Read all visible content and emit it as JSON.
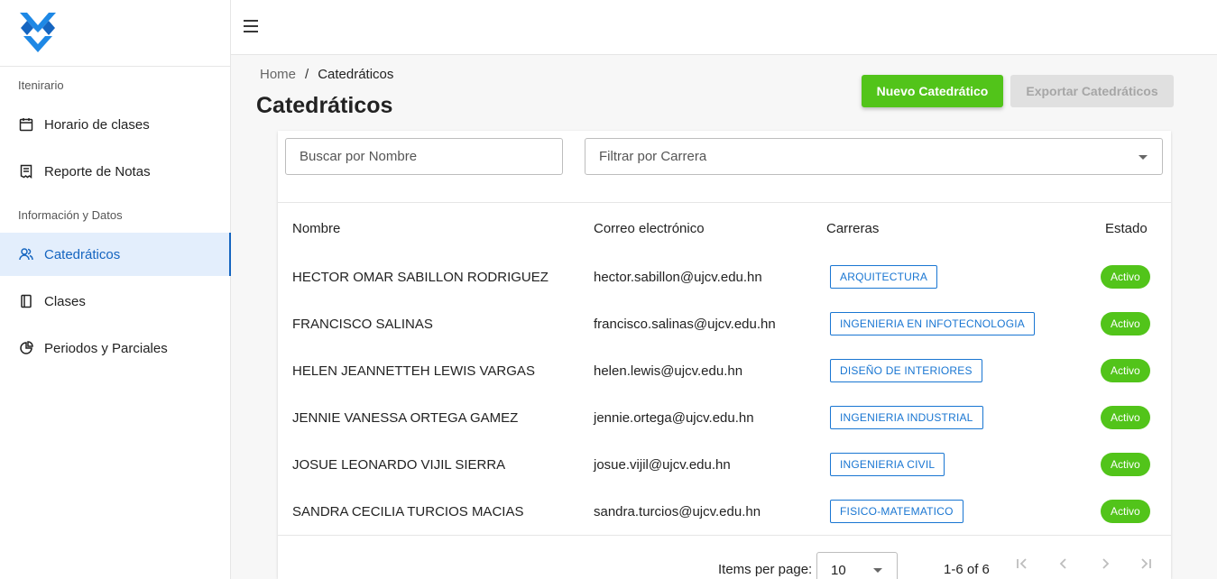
{
  "sidebar": {
    "section1": "Itenirario",
    "section2": "Información y Datos",
    "items": [
      {
        "label": "Horario de clases",
        "icon": "calendar-icon"
      },
      {
        "label": "Reporte de Notas",
        "icon": "report-icon"
      },
      {
        "label": "Catedráticos",
        "icon": "users-icon",
        "active": true
      },
      {
        "label": "Clases",
        "icon": "book-icon"
      },
      {
        "label": "Periodos y Parciales",
        "icon": "pie-chart-icon"
      }
    ]
  },
  "breadcrumb": {
    "home": "Home",
    "separator": "/",
    "current": "Catedráticos"
  },
  "page": {
    "title": "Catedráticos"
  },
  "buttons": {
    "new": "Nuevo Catedrático",
    "export": "Exportar Catedráticos"
  },
  "filters": {
    "search_placeholder": "Buscar por Nombre",
    "career_placeholder": "Filtrar por Carrera"
  },
  "table": {
    "headers": {
      "name": "Nombre",
      "email": "Correo electrónico",
      "careers": "Carreras",
      "status": "Estado"
    },
    "rows": [
      {
        "name": "HECTOR OMAR SABILLON RODRIGUEZ",
        "email": "hector.sabillon@ujcv.edu.hn",
        "career": "ARQUITECTURA",
        "status": "Activo"
      },
      {
        "name": "FRANCISCO SALINAS",
        "email": "francisco.salinas@ujcv.edu.hn",
        "career": "INGENIERIA EN INFOTECNOLOGIA",
        "status": "Activo"
      },
      {
        "name": "HELEN JEANNETTEH LEWIS VARGAS",
        "email": "helen.lewis@ujcv.edu.hn",
        "career": "DISEÑO DE INTERIORES",
        "status": "Activo"
      },
      {
        "name": "JENNIE VANESSA ORTEGA GAMEZ",
        "email": "jennie.ortega@ujcv.edu.hn",
        "career": "INGENIERIA INDUSTRIAL",
        "status": "Activo"
      },
      {
        "name": "JOSUE LEONARDO VIJIL SIERRA",
        "email": "josue.vijil@ujcv.edu.hn",
        "career": "INGENIERIA CIVIL",
        "status": "Activo"
      },
      {
        "name": "SANDRA CECILIA TURCIOS MACIAS",
        "email": "sandra.turcios@ujcv.edu.hn",
        "career": "FISICO-MATEMATICO",
        "status": "Activo"
      }
    ]
  },
  "pagination": {
    "items_per_page_label": "Items per page:",
    "items_per_page": "10",
    "range": "1-6 of 6"
  },
  "colors": {
    "primary": "#1565c0",
    "success": "#52c41a",
    "active_bg": "#e3eefc"
  }
}
